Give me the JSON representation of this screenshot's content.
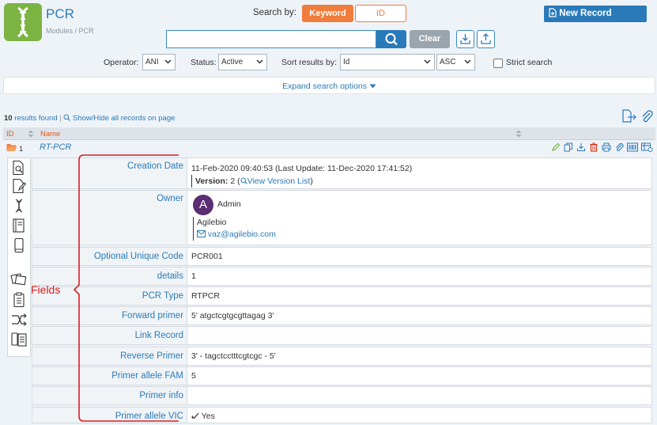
{
  "header": {
    "app_title": "PCR",
    "breadcrumb": "Modules / PCR",
    "search_by_label": "Search by:",
    "search_mode_keyword": "Keyword",
    "search_mode_id": "ID",
    "new_record_label": "New Record",
    "search_value": "",
    "clear_label": "Clear"
  },
  "filters": {
    "operator_label": "Operator:",
    "operator_value": "ANI",
    "status_label": "Status:",
    "status_value": "Active",
    "sort_label": "Sort results by:",
    "sort_value": "Id",
    "order_value": "ASC",
    "strict_label": "Strict search",
    "expand_label": "Expand search options"
  },
  "results": {
    "count": "10",
    "found_label": "results found",
    "show_hide_label": "Show/Hide all records on page"
  },
  "table": {
    "col_id": "ID",
    "col_name": "Name",
    "record_id": "1",
    "record_name": "RT-PCR"
  },
  "fields": {
    "creation_date_label": "Creation Date",
    "creation_date_value": "11-Feb-2020 09:40:53 (Last Update: 11-Dec-2020 17:41:52)",
    "version_label": "Version:",
    "version_value": "2",
    "view_version_list": "View Version List",
    "owner_label": "Owner",
    "owner_initial": "A",
    "owner_name": "Admin",
    "owner_org": "Agilebio",
    "owner_email": "vaz@agilebio.com",
    "optional_code_label": "Optional Unique Code",
    "optional_code_value": "PCR001",
    "details_label": "details",
    "details_value": "1",
    "pcr_type_label": "PCR Type",
    "pcr_type_value": "RTPCR",
    "forward_label": "Forward primer",
    "forward_value": "5' atgctcgtgcgttagag 3'",
    "link_label": "Link Record",
    "link_value": "",
    "reverse_label": "Reverse Primer",
    "reverse_value": "3' - tagctcctttcgtcgc - 5'",
    "fam_label": "Primer allele FAM",
    "fam_value": "5",
    "primer_info_label": "Primer info",
    "primer_info_value": "",
    "vic_label": "Primer allele VIC",
    "vic_value": "Yes"
  },
  "annotation": {
    "text": "Fields"
  },
  "colors": {
    "accent_blue": "#2a7ab9",
    "accent_orange": "#f07d3c",
    "annotation_red": "#d81e1e",
    "avatar_purple": "#5b2d73"
  }
}
